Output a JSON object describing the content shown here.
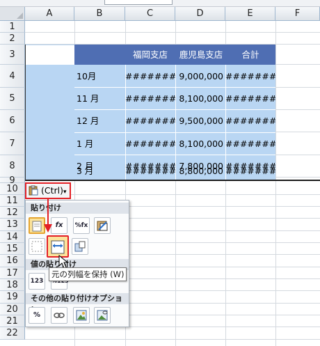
{
  "columns": [
    "A",
    "B",
    "C",
    "D",
    "E",
    "F"
  ],
  "rows": [
    "1",
    "2",
    "3",
    "4",
    "5",
    "6",
    "7",
    "8",
    "9",
    "10",
    "11",
    "12",
    "13",
    "14",
    "15",
    "16",
    "17",
    "18",
    "19",
    "20",
    "21",
    "22"
  ],
  "table": {
    "headers": [
      "福岡支店",
      "鹿児島支店",
      "合計"
    ],
    "months": [
      "10月",
      "11 月",
      "12 月",
      "1 月",
      "2 月",
      "3 月"
    ],
    "fukuoka": [
      "########",
      "########",
      "########",
      "########",
      "########",
      "########"
    ],
    "kagoshima": [
      "9,000,000",
      "8,100,000",
      "9,500,000",
      "8,100,000",
      "7,800,000",
      "8,800,000"
    ],
    "total": [
      "########",
      "########",
      "########",
      "########",
      "########",
      "########"
    ]
  },
  "paste_button": {
    "label": "(Ctrl)",
    "arrow": "▾"
  },
  "paste_menu": {
    "section_paste": "貼り付け",
    "section_values": "値の貼り付け",
    "section_other": "その他の貼り付けオプション",
    "icons_row1": [
      "paste",
      "fx",
      "%fx",
      "paste-format"
    ],
    "icons_row2": [
      "no-borders",
      "keep-column-width",
      "transpose"
    ],
    "icons_values": [
      "123",
      "%123"
    ],
    "icons_other": [
      "%",
      "link",
      "picture",
      "linked-picture"
    ]
  },
  "tooltip": "元の列幅を保持 (W)",
  "colors": {
    "header_fill": "#4f6eb3",
    "selection_fill": "#b9d6f3",
    "highlight_red": "#e32026"
  }
}
